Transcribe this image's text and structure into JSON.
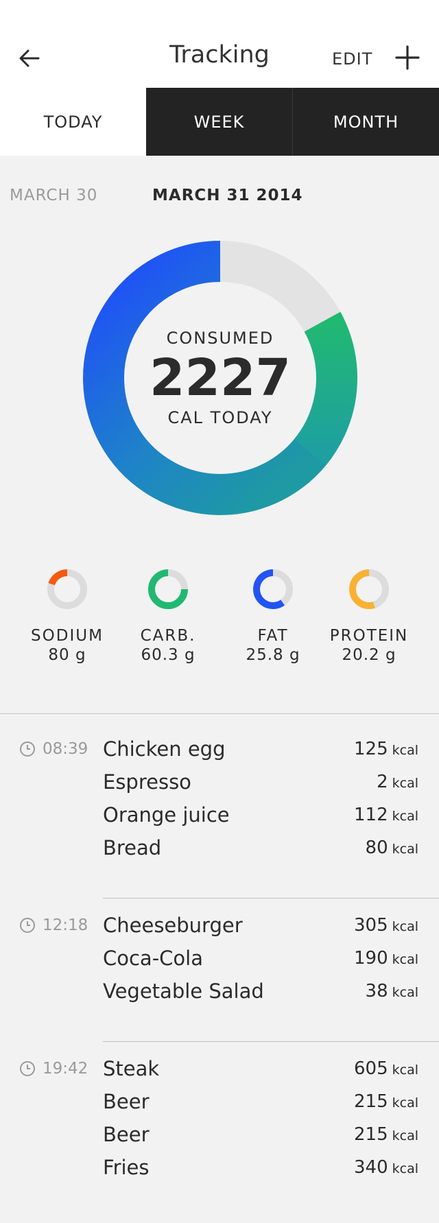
{
  "header": {
    "title": "Tracking",
    "edit_label": "EDIT",
    "back_icon": "arrow-left-icon",
    "add_icon": "plus-icon"
  },
  "tabs": [
    {
      "label": "TODAY",
      "active": true
    },
    {
      "label": "WEEK",
      "active": false
    },
    {
      "label": "MONTH",
      "active": false
    }
  ],
  "dates": {
    "previous": "MARCH 30",
    "current": "MARCH 31 2014"
  },
  "summary": {
    "label_top": "CONSUMED",
    "value": "2227",
    "label_bottom": "CAL TODAY",
    "ring": {
      "remaining_fraction": 0.17,
      "colors": {
        "track": "#e3e3e3",
        "blue": "#1f52f6",
        "green": "#21b872",
        "teal": "#1e96a8"
      }
    }
  },
  "nutrients": [
    {
      "name": "SODIUM",
      "value": "80 g",
      "fraction": 0.2,
      "color": "#f55a11"
    },
    {
      "name": "CARB.",
      "value": "60.3 g",
      "fraction": 0.75,
      "color": "#21b872"
    },
    {
      "name": "FAT",
      "value": "25.8 g",
      "fraction": 0.6,
      "color": "#2254f5"
    },
    {
      "name": "PROTEIN",
      "value": "20.2 g",
      "fraction": 0.55,
      "color": "#f7b234"
    }
  ],
  "meals": [
    {
      "time": "08:39",
      "items": [
        {
          "name": "Chicken egg",
          "kcal": "125"
        },
        {
          "name": "Espresso",
          "kcal": "2"
        },
        {
          "name": "Orange juice",
          "kcal": "112"
        },
        {
          "name": "Bread",
          "kcal": "80"
        }
      ]
    },
    {
      "time": "12:18",
      "items": [
        {
          "name": "Cheeseburger",
          "kcal": "305"
        },
        {
          "name": "Coca-Cola",
          "kcal": "190"
        },
        {
          "name": "Vegetable Salad",
          "kcal": "38"
        }
      ]
    },
    {
      "time": "19:42",
      "items": [
        {
          "name": "Steak",
          "kcal": "605"
        },
        {
          "name": "Beer",
          "kcal": "215"
        },
        {
          "name": "Beer",
          "kcal": "215"
        },
        {
          "name": "Fries",
          "kcal": "340"
        }
      ]
    }
  ],
  "kcal_unit": "kcal",
  "clock_icon": "clock-icon"
}
